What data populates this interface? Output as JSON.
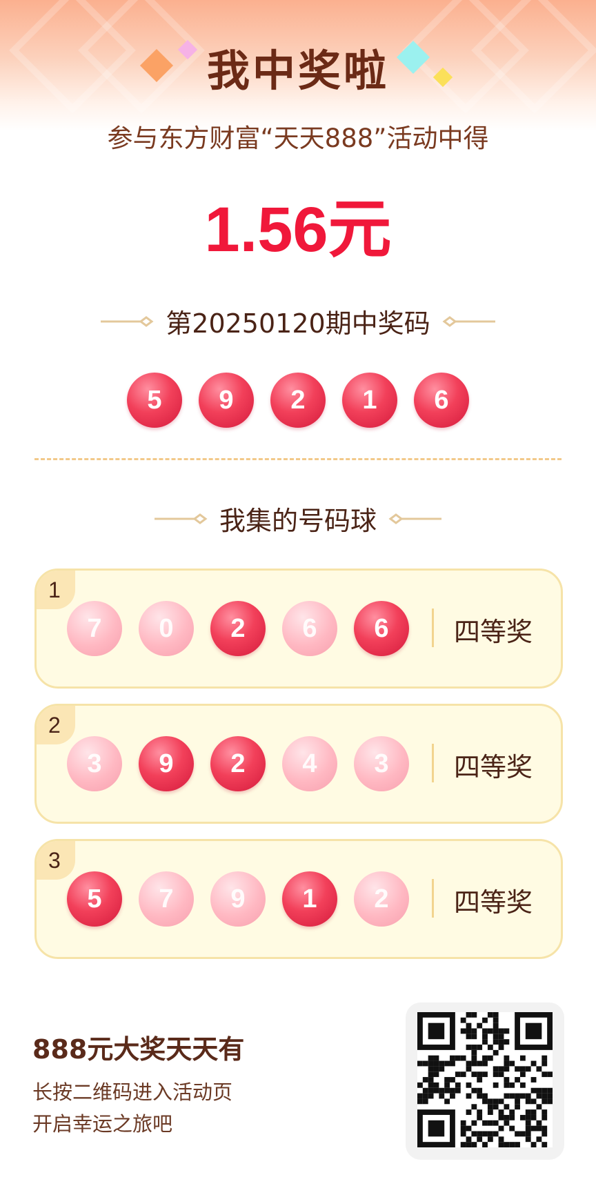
{
  "header": {
    "title": "我中奖啦",
    "subtitle": "参与东方财富“天天888”活动中得",
    "amount": "1.56元"
  },
  "draw": {
    "title": "第20250120期中奖码",
    "numbers": [
      "5",
      "9",
      "2",
      "1",
      "6"
    ]
  },
  "collection": {
    "title": "我集的号码球",
    "rows": [
      {
        "index": "1",
        "balls": [
          {
            "n": "7",
            "hit": false
          },
          {
            "n": "0",
            "hit": false
          },
          {
            "n": "2",
            "hit": true
          },
          {
            "n": "6",
            "hit": false
          },
          {
            "n": "6",
            "hit": true
          }
        ],
        "prize": "四等奖"
      },
      {
        "index": "2",
        "balls": [
          {
            "n": "3",
            "hit": false
          },
          {
            "n": "9",
            "hit": true
          },
          {
            "n": "2",
            "hit": true
          },
          {
            "n": "4",
            "hit": false
          },
          {
            "n": "3",
            "hit": false
          }
        ],
        "prize": "四等奖"
      },
      {
        "index": "3",
        "balls": [
          {
            "n": "5",
            "hit": true
          },
          {
            "n": "7",
            "hit": false
          },
          {
            "n": "9",
            "hit": false
          },
          {
            "n": "1",
            "hit": true
          },
          {
            "n": "2",
            "hit": false
          }
        ],
        "prize": "四等奖"
      }
    ]
  },
  "footer": {
    "title": "888元大奖天天有",
    "line1": "长按二维码进入活动页",
    "line2": "开启幸运之旅吧"
  },
  "colors": {
    "accent_red": "#f0183a",
    "title_brown": "#6b2a16",
    "card_bg": "#fffbe3",
    "card_border": "#f6e3a8"
  }
}
